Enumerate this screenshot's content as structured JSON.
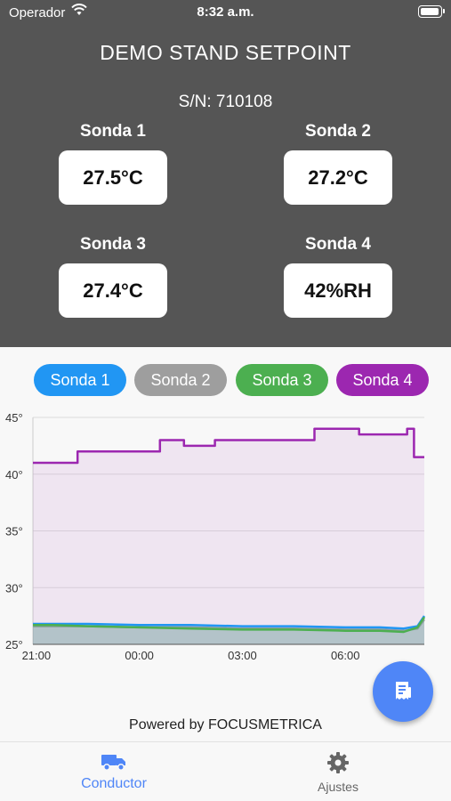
{
  "status_bar": {
    "carrier": "Operador",
    "time": "8:32 a.m."
  },
  "header": {
    "title": "DEMO STAND SETPOINT",
    "serial": "S/N: 710108"
  },
  "probes": [
    {
      "label": "Sonda 1",
      "value": "27.5°C"
    },
    {
      "label": "Sonda 2",
      "value": "27.2°C"
    },
    {
      "label": "Sonda 3",
      "value": "27.4°C"
    },
    {
      "label": "Sonda 4",
      "value": "42%RH"
    }
  ],
  "chips": [
    {
      "label": "Sonda 1",
      "color": "#2196f3"
    },
    {
      "label": "Sonda 2",
      "color": "#9e9e9e"
    },
    {
      "label": "Sonda 3",
      "color": "#4caf50"
    },
    {
      "label": "Sonda 4",
      "color": "#9c27b0"
    }
  ],
  "chart_data": {
    "type": "line",
    "y_ticks": [
      "45°",
      "40°",
      "35°",
      "30°",
      "25°"
    ],
    "x_ticks": [
      "21:00",
      "00:00",
      "03:00",
      "06:00"
    ],
    "ylim": [
      25,
      45
    ],
    "grid": true,
    "series": [
      {
        "name": "Sonda 1",
        "color": "#2196f3",
        "x": [
          20.9,
          21.5,
          22.5,
          24,
          25.5,
          27,
          28.5,
          30,
          31,
          31.7,
          32.1,
          32.3
        ],
        "y": [
          26.8,
          26.8,
          26.8,
          26.7,
          26.7,
          26.6,
          26.6,
          26.5,
          26.5,
          26.4,
          26.6,
          27.5
        ]
      },
      {
        "name": "Sonda 2",
        "color": "#9e9e9e",
        "x": [
          20.9,
          21.5,
          22.5,
          24,
          25.5,
          27,
          28.5,
          30,
          31,
          31.7,
          32.1,
          32.3
        ],
        "y": [
          26.6,
          26.6,
          26.6,
          26.5,
          26.5,
          26.4,
          26.4,
          26.3,
          26.3,
          26.2,
          26.4,
          27.2
        ]
      },
      {
        "name": "Sonda 3",
        "color": "#4caf50",
        "x": [
          20.9,
          21.5,
          22.5,
          24,
          25.5,
          27,
          28.5,
          30,
          31,
          31.7,
          32.1,
          32.3
        ],
        "y": [
          26.7,
          26.7,
          26.6,
          26.5,
          26.4,
          26.3,
          26.3,
          26.2,
          26.2,
          26.1,
          26.5,
          27.4
        ]
      },
      {
        "name": "Sonda 4",
        "color": "#9c27b0",
        "x": [
          20.9,
          22.2,
          22.2,
          24.6,
          24.6,
          25.3,
          25.3,
          26.2,
          26.2,
          29.1,
          29.1,
          30.4,
          30.4,
          31.8,
          31.8,
          32.0,
          32.0,
          32.3
        ],
        "y": [
          41,
          41,
          42,
          42,
          43,
          43,
          42.5,
          42.5,
          43,
          43,
          44,
          44,
          43.5,
          43.5,
          44,
          44,
          41.5,
          41.5
        ]
      }
    ]
  },
  "fab": {
    "icon": "receipt-icon"
  },
  "footer": {
    "powered": "Powered by FOCUSMETRICA"
  },
  "tabs": [
    {
      "label": "Conductor",
      "icon": "truck-icon",
      "active": true
    },
    {
      "label": "Ajustes",
      "icon": "gear-icon",
      "active": false
    }
  ]
}
